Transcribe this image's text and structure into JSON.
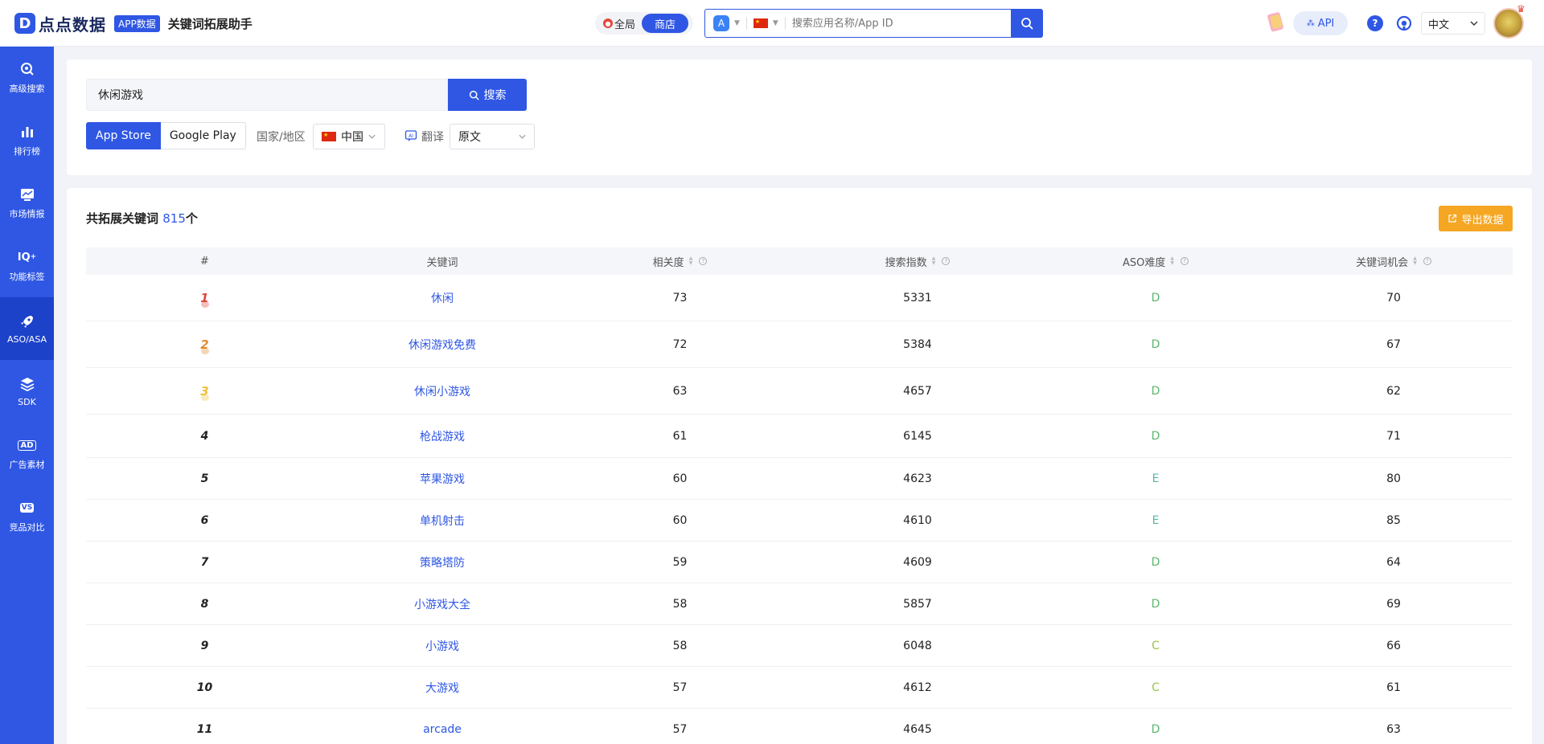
{
  "header": {
    "logo_mark": "D",
    "logo_text": "点点数据",
    "app_badge": "APP数据",
    "tool_title": "关键词拓展助手",
    "scope_all": "全局",
    "scope_store": "商店",
    "search_placeholder": "搜索应用名称/App ID",
    "api_label": "API",
    "help_label": "?",
    "language": "中文"
  },
  "sidebar": {
    "items": [
      {
        "label": "高级搜索",
        "icon": "advanced-search-icon"
      },
      {
        "label": "排行榜",
        "icon": "ranking-icon"
      },
      {
        "label": "市场情报",
        "icon": "market-intel-icon"
      },
      {
        "label": "功能标签",
        "icon": "feature-tag-icon"
      },
      {
        "label": "ASO/ASA",
        "icon": "rocket-icon"
      },
      {
        "label": "SDK",
        "icon": "layers-icon"
      },
      {
        "label": "广告素材",
        "icon": "ad-icon"
      },
      {
        "label": "竞品对比",
        "icon": "vs-icon"
      }
    ],
    "active_index": 4,
    "iq_glyph": "IQ",
    "ad_glyph": "AD",
    "vs_glyph": "VS"
  },
  "filters": {
    "keyword_value": "休闲游戏",
    "search_button": "搜索",
    "store_tabs": [
      "App Store",
      "Google Play"
    ],
    "active_store": "App Store",
    "region_label": "国家/地区",
    "region_value": "中国",
    "translate_label": "翻译",
    "translate_value": "原文"
  },
  "results": {
    "title": "共拓展关键词",
    "count": "815",
    "count_unit": "个",
    "export_label": "导出数据",
    "columns": [
      "#",
      "关键词",
      "相关度",
      "搜索指数",
      "ASO难度",
      "关键词机会"
    ],
    "rows": [
      {
        "rank": "1",
        "keyword": "休闲",
        "relevance": "73",
        "search_index": "5331",
        "difficulty": "D",
        "opportunity": "70"
      },
      {
        "rank": "2",
        "keyword": "休闲游戏免费",
        "relevance": "72",
        "search_index": "5384",
        "difficulty": "D",
        "opportunity": "67"
      },
      {
        "rank": "3",
        "keyword": "休闲小游戏",
        "relevance": "63",
        "search_index": "4657",
        "difficulty": "D",
        "opportunity": "62"
      },
      {
        "rank": "4",
        "keyword": "枪战游戏",
        "relevance": "61",
        "search_index": "6145",
        "difficulty": "D",
        "opportunity": "71"
      },
      {
        "rank": "5",
        "keyword": "苹果游戏",
        "relevance": "60",
        "search_index": "4623",
        "difficulty": "E",
        "opportunity": "80"
      },
      {
        "rank": "6",
        "keyword": "单机射击",
        "relevance": "60",
        "search_index": "4610",
        "difficulty": "E",
        "opportunity": "85"
      },
      {
        "rank": "7",
        "keyword": "策略塔防",
        "relevance": "59",
        "search_index": "4609",
        "difficulty": "D",
        "opportunity": "64"
      },
      {
        "rank": "8",
        "keyword": "小游戏大全",
        "relevance": "58",
        "search_index": "5857",
        "difficulty": "D",
        "opportunity": "69"
      },
      {
        "rank": "9",
        "keyword": "小游戏",
        "relevance": "58",
        "search_index": "6048",
        "difficulty": "C",
        "opportunity": "66"
      },
      {
        "rank": "10",
        "keyword": "大游戏",
        "relevance": "57",
        "search_index": "4612",
        "difficulty": "C",
        "opportunity": "61"
      },
      {
        "rank": "11",
        "keyword": "arcade",
        "relevance": "57",
        "search_index": "4645",
        "difficulty": "D",
        "opportunity": "63"
      }
    ]
  },
  "colors": {
    "brand": "#2f57e4",
    "export": "#f5a623",
    "difficulty_D": "#5db56e",
    "difficulty_E": "#57b9a6",
    "difficulty_C": "#9ac24d"
  }
}
